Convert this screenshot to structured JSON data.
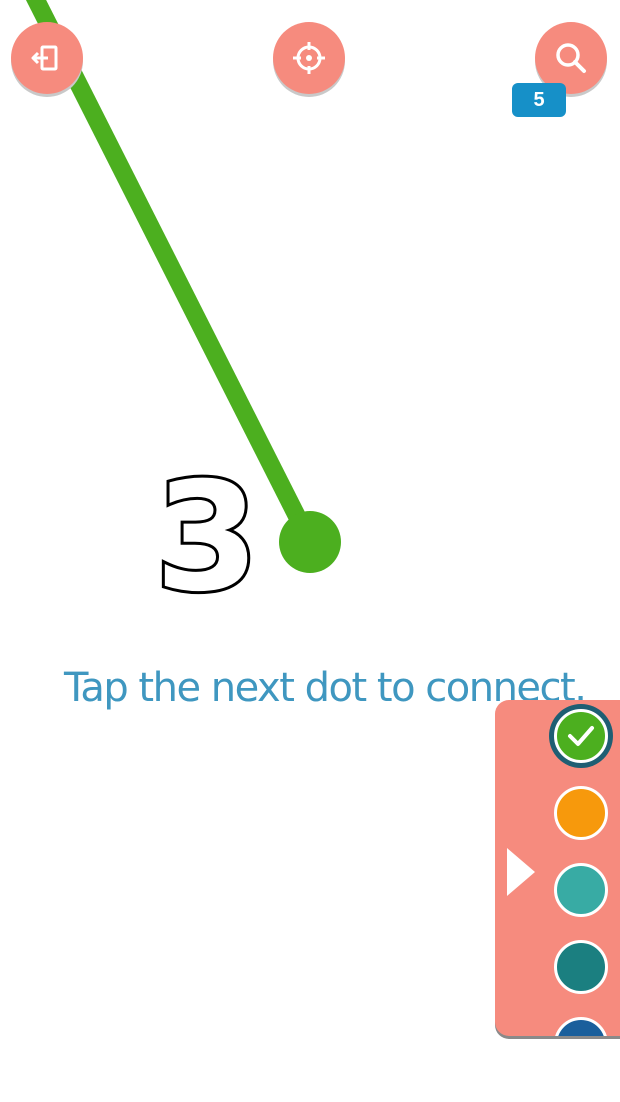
{
  "toolbar": {
    "exit_icon": "exit-icon",
    "center_icon": "crosshair-icon",
    "search_icon": "search-icon",
    "hint_count": "5",
    "button_color": "#f68b7e",
    "badge_color": "#1690c8"
  },
  "game": {
    "current_dot_number": "3",
    "line_color": "#4caf1f",
    "instruction": "Tap the next dot to connect."
  },
  "palette": {
    "toggle_icon": "triangle-right-icon",
    "panel_color": "#f68b7e",
    "colors": [
      {
        "name": "green",
        "color": "#4caf1f",
        "selected": true
      },
      {
        "name": "orange",
        "color": "#f7990c",
        "selected": false
      },
      {
        "name": "teal-light",
        "color": "#38aba4",
        "selected": false
      },
      {
        "name": "teal-dark",
        "color": "#1b7f80",
        "selected": false
      },
      {
        "name": "blue",
        "color": "#1a5f9c",
        "selected": false
      }
    ]
  }
}
